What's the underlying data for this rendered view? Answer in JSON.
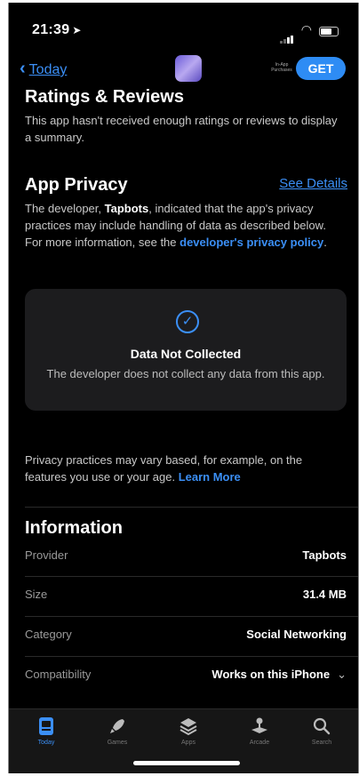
{
  "status": {
    "time": "21:39",
    "location_icon": "location-arrow-icon"
  },
  "nav": {
    "back_label": "Today",
    "in_app_label_1": "In-App",
    "in_app_label_2": "Purchases",
    "get_label": "GET"
  },
  "ratings": {
    "title": "Ratings & Reviews",
    "text": "This app hasn't received enough ratings or reviews to display a summary."
  },
  "privacy": {
    "title": "App Privacy",
    "see_details": "See Details",
    "text_before": "The developer, ",
    "developer": "Tapbots",
    "text_after": ", indicated that the app's privacy practices may include handling of data as described below. For more information, see the ",
    "policy_link": "developer's privacy policy",
    "text_end": ".",
    "card_title": "Data Not Collected",
    "card_text": "The developer does not collect any data from this app.",
    "note": "Privacy practices may vary based, for example, on the features you use or your age. ",
    "learn_more": "Learn More"
  },
  "information": {
    "title": "Information",
    "rows": [
      {
        "key": "Provider",
        "value": "Tapbots"
      },
      {
        "key": "Size",
        "value": "31.4 MB"
      },
      {
        "key": "Category",
        "value": "Social Networking"
      },
      {
        "key": "Compatibility",
        "value": "Works on this iPhone"
      }
    ]
  },
  "tabs": [
    {
      "label": "Today",
      "icon": "today-icon",
      "active": true
    },
    {
      "label": "Games",
      "icon": "rocket-icon",
      "active": false
    },
    {
      "label": "Apps",
      "icon": "apps-stack-icon",
      "active": false
    },
    {
      "label": "Arcade",
      "icon": "joystick-icon",
      "active": false
    },
    {
      "label": "Search",
      "icon": "search-icon",
      "active": false
    }
  ],
  "colors": {
    "accent": "#3b8ff6",
    "background": "#000000",
    "card": "#1c1c1e"
  }
}
